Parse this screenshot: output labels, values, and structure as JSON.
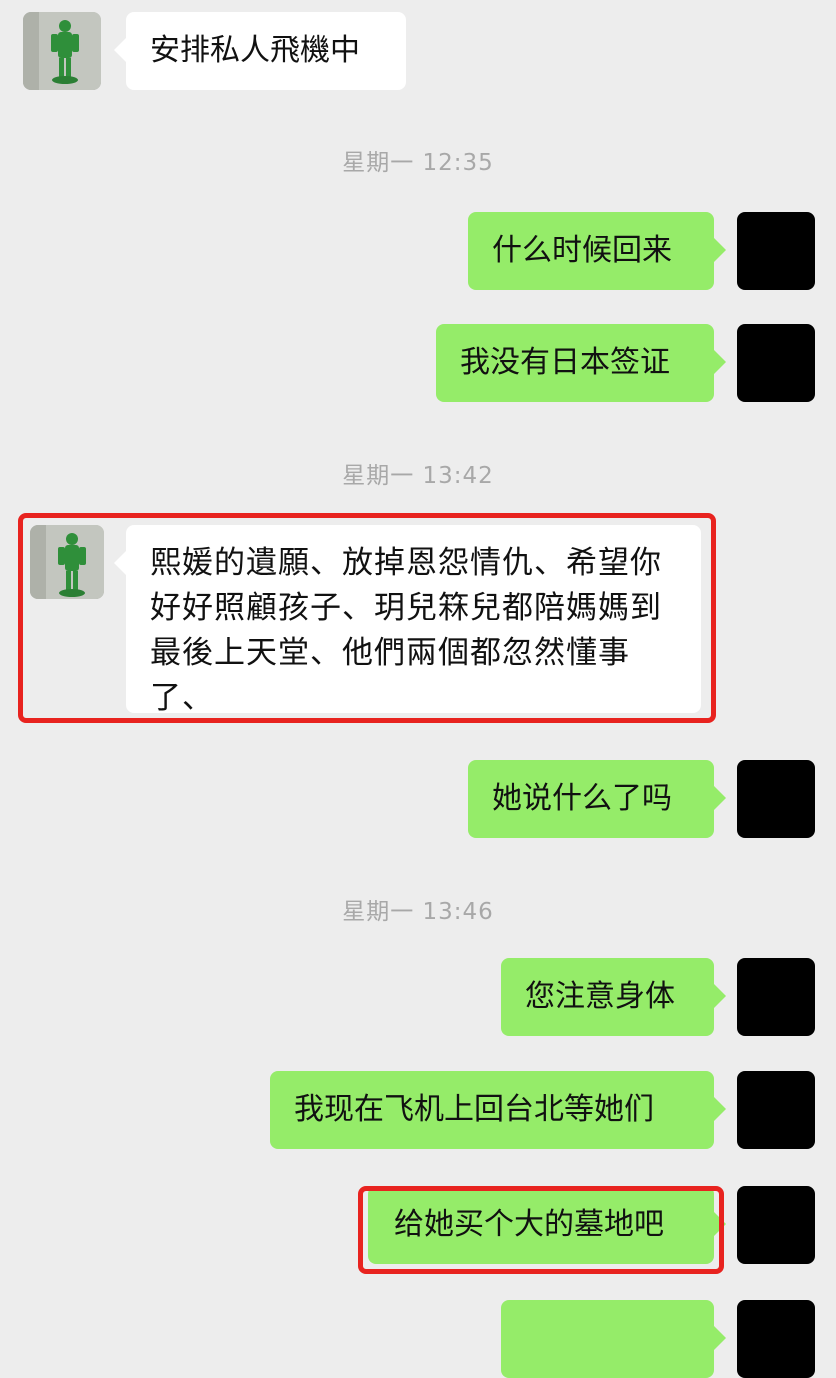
{
  "messages": [
    {
      "side": "left",
      "text": "安排私人飛機中"
    },
    {
      "type": "timestamp",
      "text": "星期一 12:35"
    },
    {
      "side": "right",
      "text": "什么时候回来"
    },
    {
      "side": "right",
      "text": "我没有日本签证"
    },
    {
      "type": "timestamp",
      "text": "星期一 13:42"
    },
    {
      "side": "left",
      "text": "熙媛的遺願、放掉恩怨情仇、希望你好好照顧孩子、玥兒箖兒都陪媽媽到最後上天堂、他們兩個都忽然懂事了、",
      "lines": [
        "熙媛的遺願、放掉恩怨情仇、希望你",
        "好好照顧孩子、玥兒箖兒都陪媽媽到",
        "最後上天堂、他們兩個都忽然懂事",
        "了、"
      ],
      "highlighted": true
    },
    {
      "side": "right",
      "text": "她说什么了吗"
    },
    {
      "type": "timestamp",
      "text": "星期一 13:46"
    },
    {
      "side": "right",
      "text": "您注意身体"
    },
    {
      "side": "right",
      "text": "我现在飞机上回台北等她们"
    },
    {
      "side": "right",
      "text": "给她买个大的墓地吧",
      "highlighted": true
    }
  ],
  "colors": {
    "background": "#ededed",
    "incoming_bubble": "#ffffff",
    "outgoing_bubble": "#95ec69",
    "highlight": "#e8231f",
    "timestamp": "#a8a8a8"
  },
  "icons": {
    "contact_avatar": "green-figurine-avatar",
    "self_avatar": "black-square-avatar"
  }
}
